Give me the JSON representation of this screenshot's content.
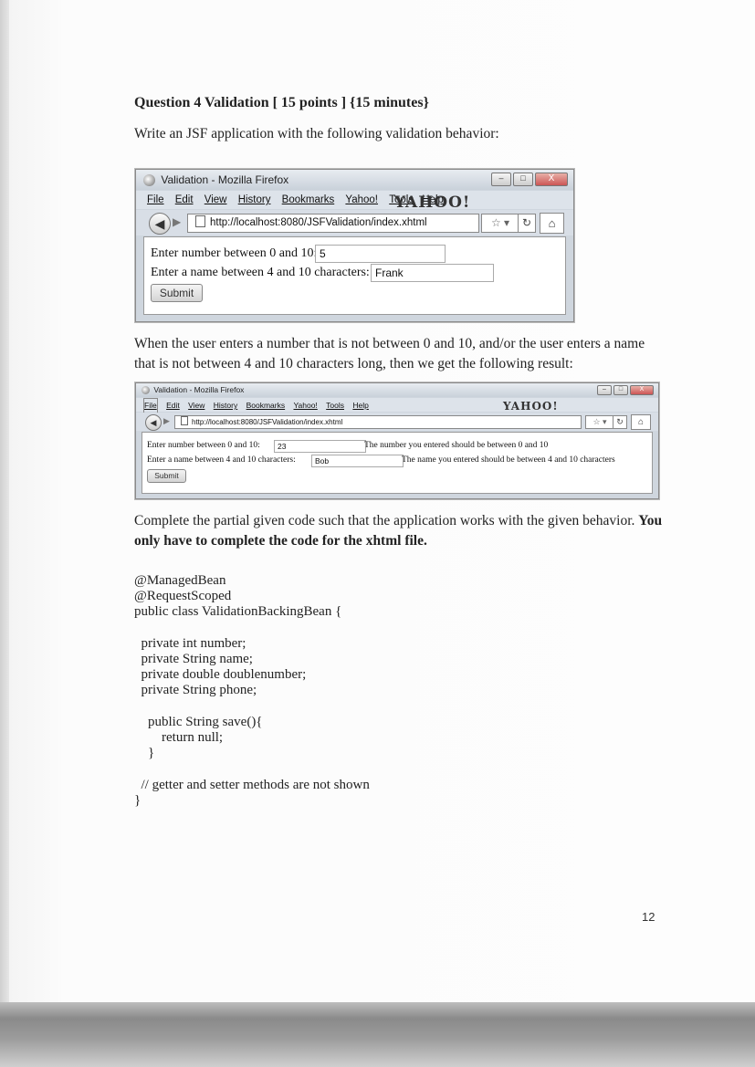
{
  "question": {
    "title": "Question 4 Validation [ 15 points ] {15 minutes}",
    "intro": "Write an JSF application with the following validation behavior:",
    "middle": "When the user enters a number that is not between 0 and 10, and/or the user enters a name that is not between 4 and 10 characters long, then we get the following result:",
    "complete_normal": "Complete the partial given code such that the application works with the given behavior. ",
    "complete_bold": "You only have to complete the code for the xhtml file."
  },
  "browser": {
    "window_title": "Validation - Mozilla Firefox",
    "menu": [
      "File",
      "Edit",
      "View",
      "History",
      "Bookmarks",
      "Yahoo!",
      "Tools",
      "Help"
    ],
    "url": "http://localhost:8080/JSFValidation/index.xhtml",
    "brand": "YAHOO!",
    "min_icon": "minimize-icon",
    "max_icon": "maximize-icon",
    "close_icon": "close-icon"
  },
  "form1": {
    "number_label": "Enter number between 0 and 10:",
    "number_value": "5",
    "name_label": "Enter a name between 4 and 10 characters:",
    "name_value": "Frank",
    "submit_label": "Submit"
  },
  "form2": {
    "number_label": "Enter number between 0 and 10:",
    "number_value": "23",
    "number_error": "The number you entered should be between 0 and 10",
    "name_label": "Enter a name between 4 and 10 characters:",
    "name_value": "Bob",
    "name_error": "The name you entered should be between 4 and 10 characters",
    "submit_label": "Submit"
  },
  "code": [
    "@ManagedBean",
    "@RequestScoped",
    "public class ValidationBackingBean {",
    "",
    "  private int number;",
    "  private String name;",
    "  private double doublenumber;",
    "  private String phone;",
    "",
    "    public String save(){",
    "        return null;",
    "    }",
    "",
    "  // getter and setter methods are not shown",
    "}"
  ],
  "page_number": "12"
}
